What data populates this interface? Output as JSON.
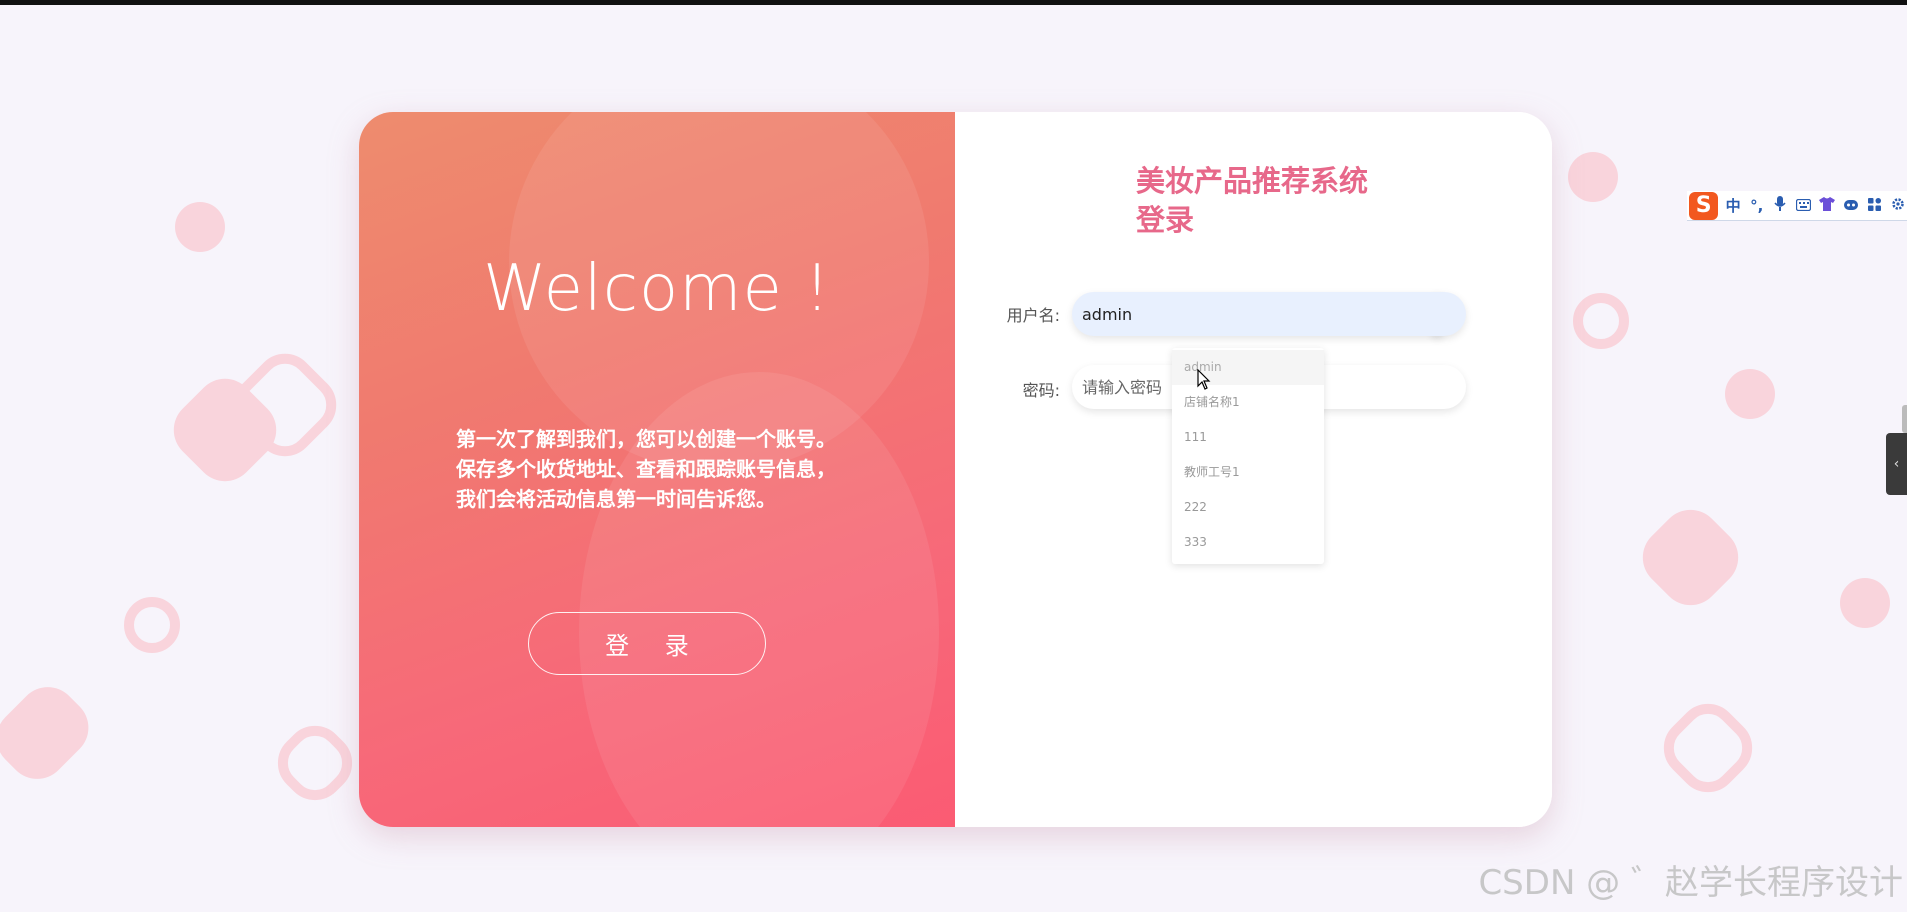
{
  "left": {
    "welcome": "Welcome !",
    "intro_lines": [
      "第一次了解到我们，您可以创建一个账号。",
      "保存多个收货地址、查看和跟踪账号信息，",
      "我们会将活动信息第一时间告诉您。"
    ],
    "login_button": "登 录"
  },
  "right": {
    "title_line1": "美妆产品推荐系统",
    "title_line2": "登录",
    "username_label": "用户名:",
    "username_value": "admin",
    "password_label": "密码:",
    "password_placeholder": "请输入密码"
  },
  "autocomplete": {
    "items": [
      "admin",
      "店铺名称1",
      "111",
      "教师工号1",
      "222",
      "333"
    ]
  },
  "ime": {
    "logo": "S",
    "icons": [
      "中",
      "°,",
      "mic-icon",
      "keyboard-icon",
      "shirt-icon",
      "robot-icon",
      "grid-icon",
      "gear-icon"
    ]
  },
  "watermark": "CSDN @ ゛赵学长程序设计",
  "colors": {
    "accent": "#e7688a",
    "panel_start": "#ee8c6e",
    "panel_end": "#fb5b73",
    "background": "#f7f4fb"
  }
}
